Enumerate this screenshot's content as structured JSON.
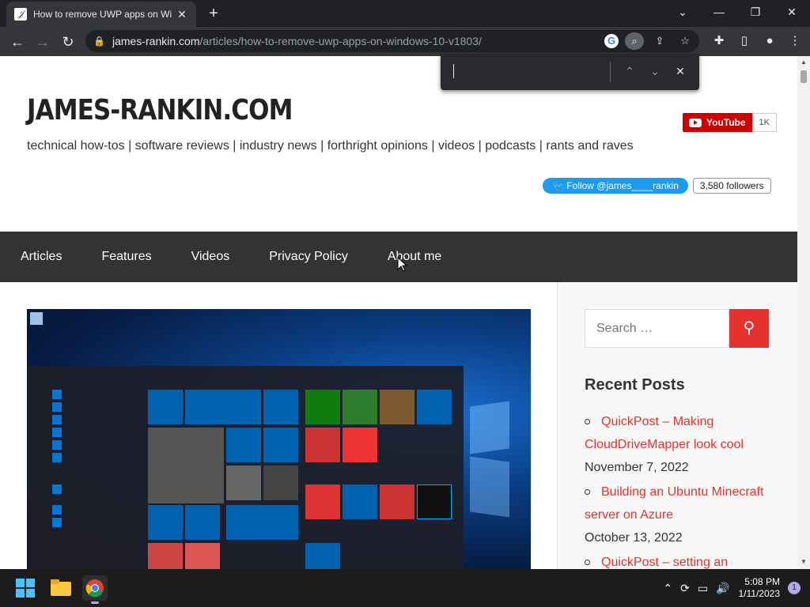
{
  "browser": {
    "tab_title": "How to remove UWP apps on Wi",
    "tab_close": "✕",
    "new_tab": "+",
    "url_host": "james-rankin.com",
    "url_path": "/articles/how-to-remove-uwp-apps-on-windows-10-v1803/"
  },
  "find_bar": {
    "query": "",
    "prev": "⌃",
    "next": "⌄",
    "close": "✕"
  },
  "site": {
    "title": "JAMES-RANKIN.COM",
    "tagline": "technical how-tos | software reviews | industry news | forthright opinions | videos | podcasts | rants and raves",
    "youtube_label": "YouTube",
    "youtube_count": "1K",
    "twitter_label": "Follow @james____rankin",
    "twitter_count": "3,580 followers"
  },
  "nav": [
    "Articles",
    "Features",
    "Videos",
    "Privacy Policy",
    "About me"
  ],
  "sidebar": {
    "search_placeholder": "Search …",
    "recent_heading": "Recent Posts",
    "posts": [
      {
        "title": "QuickPost – Making CloudDriveMapper look cool",
        "date": "November 7, 2022"
      },
      {
        "title": "Building an Ubuntu Minecraft server on Azure",
        "date": "October 13, 2022"
      },
      {
        "title": "QuickPost – setting an",
        "date": ""
      }
    ]
  },
  "taskbar": {
    "time": "5:08 PM",
    "date": "1/11/2023",
    "notification_count": "1"
  },
  "colors": {
    "accent_red": "#e5322d",
    "nav_bg": "#333333",
    "youtube_red": "#cc0000",
    "twitter_blue": "#1d9bf0"
  }
}
